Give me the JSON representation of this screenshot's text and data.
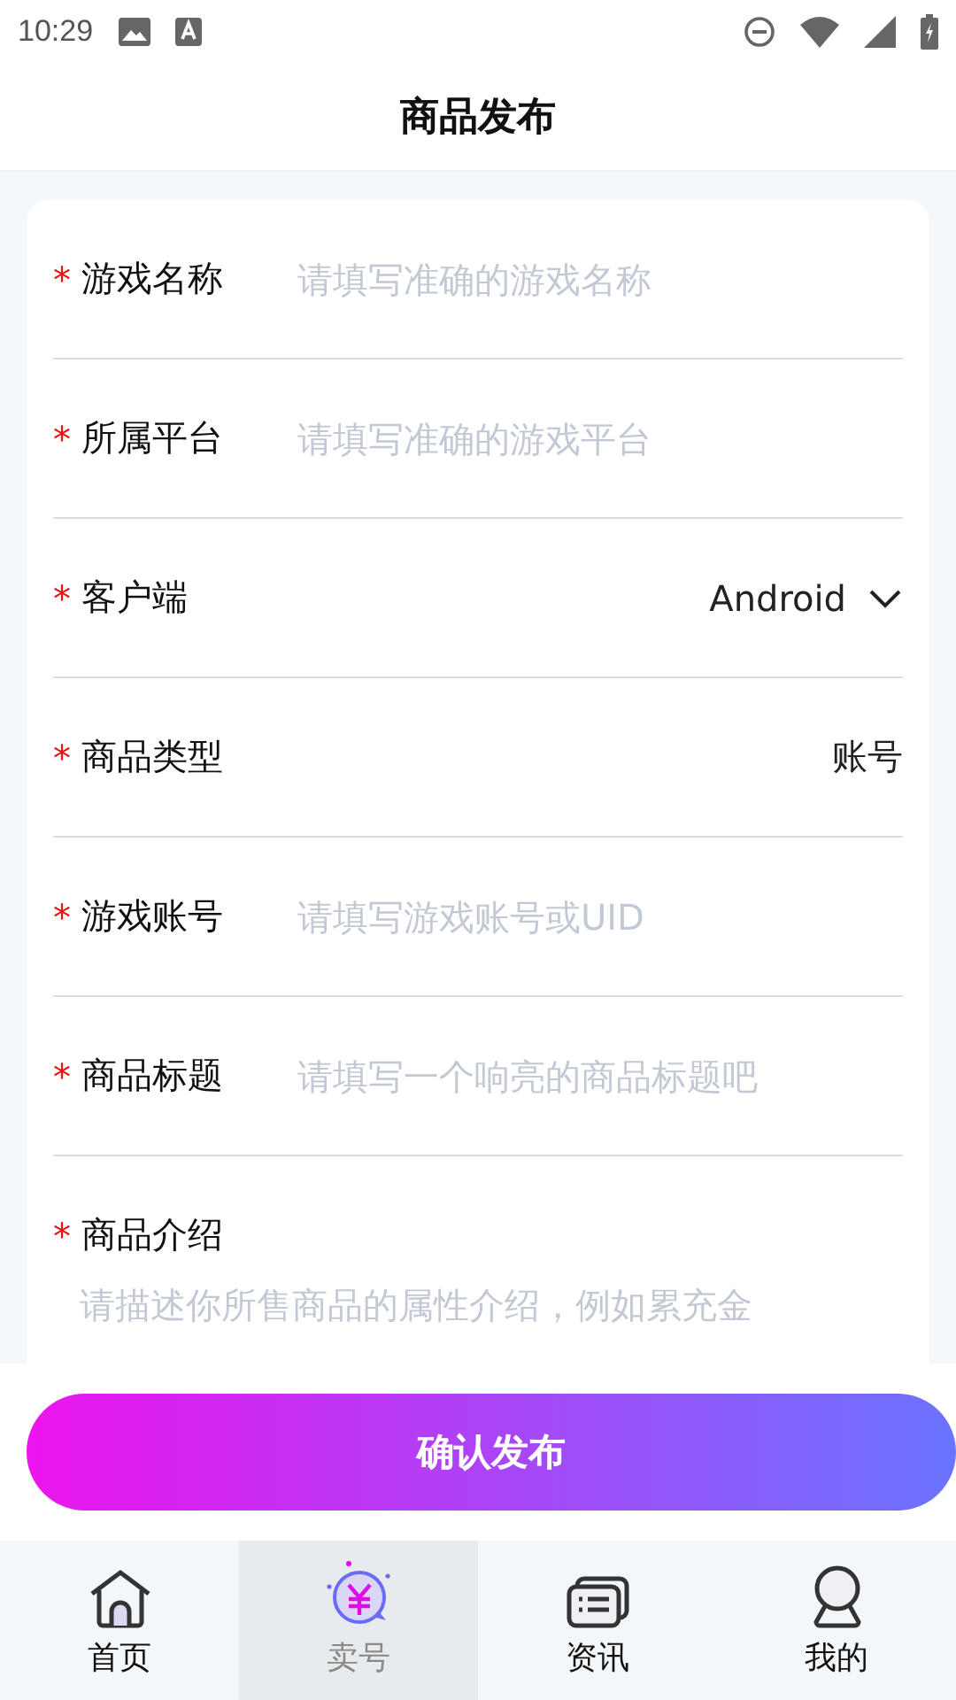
{
  "status_bar": {
    "time": "10:29"
  },
  "header": {
    "title": "商品发布"
  },
  "form": {
    "fields": [
      {
        "kind": "input",
        "required": "*",
        "label": "游戏名称",
        "placeholder": "请填写准确的游戏名称"
      },
      {
        "kind": "input",
        "required": "*",
        "label": "所属平台",
        "placeholder": "请填写准确的游戏平台"
      },
      {
        "kind": "select",
        "required": "*",
        "label": "客户端",
        "value": "Android"
      },
      {
        "kind": "value",
        "required": "*",
        "label": "商品类型",
        "value": "账号"
      },
      {
        "kind": "input",
        "required": "*",
        "label": "游戏账号",
        "placeholder": "请填写游戏账号或UID"
      },
      {
        "kind": "input",
        "required": "*",
        "label": "商品标题",
        "placeholder": "请填写一个响亮的商品标题吧"
      },
      {
        "kind": "textarea",
        "required": "*",
        "label": "商品介绍",
        "placeholder": "请描述你所售商品的属性介绍，例如累充金"
      }
    ]
  },
  "submit_button": "确认发布",
  "tab_bar": [
    {
      "kind": "home",
      "label": "首页",
      "selected": false
    },
    {
      "kind": "sell",
      "label": "卖号",
      "selected": true
    },
    {
      "kind": "news",
      "label": "资讯",
      "selected": false
    },
    {
      "kind": "me",
      "label": "我的",
      "selected": false
    }
  ]
}
